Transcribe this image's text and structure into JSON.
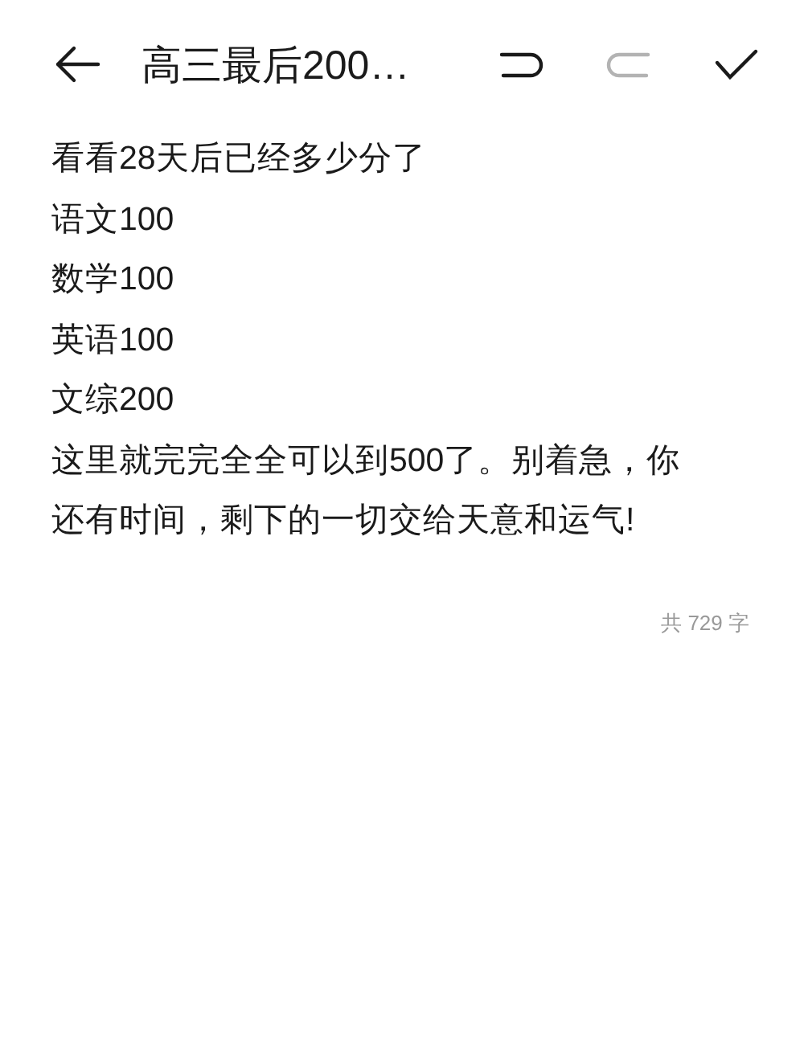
{
  "toolbar": {
    "title": "高三最后200…",
    "undo": {
      "disabled": false
    },
    "redo": {
      "disabled": true
    }
  },
  "note": {
    "paragraphs": [
      "看看28天后已经多少分了",
      "语文100",
      "数学100",
      "英语100",
      "文综200",
      "这里就完完全全可以到500了。别着急，你还有时间，剩下的一切交给天意和运气!"
    ]
  },
  "word_count": "共 729 字"
}
